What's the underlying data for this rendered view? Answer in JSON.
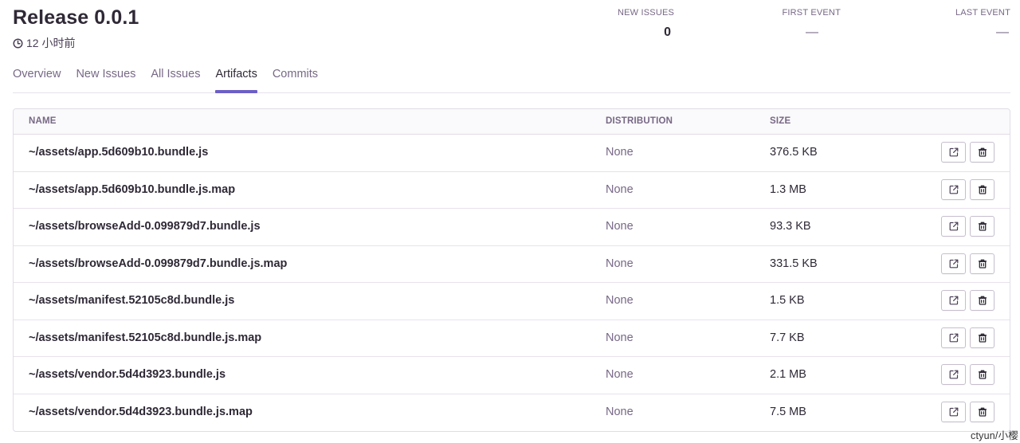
{
  "release": {
    "title": "Release 0.0.1",
    "age": "12 小时前",
    "age_icon": "clock-icon"
  },
  "stats": {
    "new_issues": {
      "label": "NEW ISSUES",
      "value": "0"
    },
    "first_event": {
      "label": "FIRST EVENT",
      "value": "—"
    },
    "last_event": {
      "label": "LAST EVENT",
      "value": "—"
    }
  },
  "tabs": [
    {
      "label": "Overview",
      "active": false
    },
    {
      "label": "New Issues",
      "active": false
    },
    {
      "label": "All Issues",
      "active": false
    },
    {
      "label": "Artifacts",
      "active": true
    },
    {
      "label": "Commits",
      "active": false
    }
  ],
  "table": {
    "headers": {
      "name": "NAME",
      "distribution": "DISTRIBUTION",
      "size": "SIZE"
    },
    "rows": [
      {
        "name": "~/assets/app.5d609b10.bundle.js",
        "distribution": "None",
        "size": "376.5 KB"
      },
      {
        "name": "~/assets/app.5d609b10.bundle.js.map",
        "distribution": "None",
        "size": "1.3 MB"
      },
      {
        "name": "~/assets/browseAdd-0.099879d7.bundle.js",
        "distribution": "None",
        "size": "93.3 KB"
      },
      {
        "name": "~/assets/browseAdd-0.099879d7.bundle.js.map",
        "distribution": "None",
        "size": "331.5 KB"
      },
      {
        "name": "~/assets/manifest.52105c8d.bundle.js",
        "distribution": "None",
        "size": "1.5 KB"
      },
      {
        "name": "~/assets/manifest.52105c8d.bundle.js.map",
        "distribution": "None",
        "size": "7.7 KB"
      },
      {
        "name": "~/assets/vendor.5d4d3923.bundle.js",
        "distribution": "None",
        "size": "2.1 MB"
      },
      {
        "name": "~/assets/vendor.5d4d3923.bundle.js.map",
        "distribution": "None",
        "size": "7.5 MB"
      }
    ],
    "row_actions": {
      "open_icon": "external-link-icon",
      "delete_icon": "trash-icon"
    }
  },
  "watermark": "ctyun/小樱",
  "colors": {
    "accent": "#6c5fc7",
    "text": "#2f2936",
    "muted": "#776886",
    "border": "#e2dbe8"
  }
}
